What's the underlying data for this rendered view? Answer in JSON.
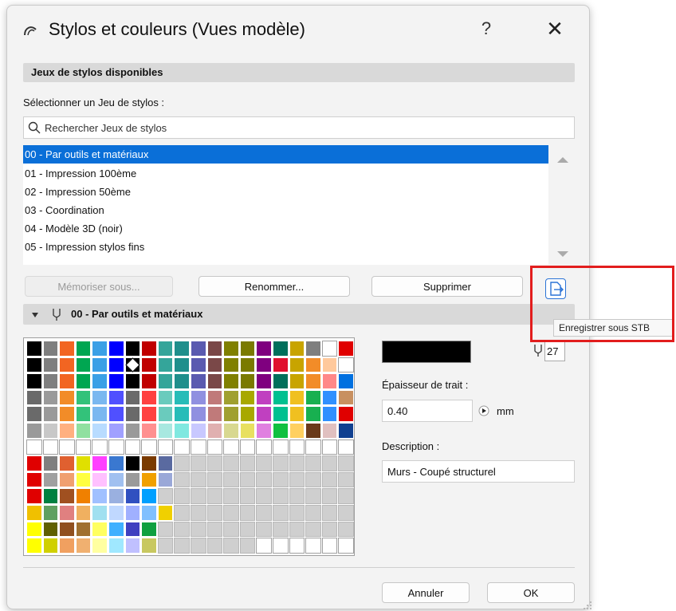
{
  "window": {
    "title": "Stylos et couleurs (Vues modèle)",
    "help": "?",
    "close": "✕"
  },
  "pen_sets": {
    "section_title": "Jeux de stylos disponibles",
    "select_label": "Sélectionner un Jeu de stylos :",
    "search_placeholder": "Rechercher Jeux de stylos",
    "items": [
      "00 - Par outils et matériaux",
      "01 - Impression 100ème",
      "02 - Impression 50ème",
      "03 - Coordination",
      "04 - Modèle 3D (noir)",
      "05 - Impression stylos fins"
    ],
    "selected_index": 0
  },
  "buttons": {
    "save_as": "Mémoriser sous...",
    "rename": "Renommer...",
    "delete": "Supprimer",
    "cancel": "Annuler",
    "ok": "OK"
  },
  "tooltip": "Enregistrer sous STB",
  "pen": {
    "set_name": "00 - Par outils et matériaux",
    "number": "27",
    "color": "#000000",
    "thickness_label": "Épaisseur de trait :",
    "thickness_value": "0.40",
    "thickness_unit": "mm",
    "description_label": "Description :",
    "description_value": "Murs - Coupé structurel"
  },
  "colors": {
    "accent": "#0a6fd8",
    "highlight": "#e21d1d"
  },
  "palette": {
    "columns": 20,
    "selected": [
      5,
      2
    ],
    "rows": [
      [
        "#000000",
        "#7f7f7f",
        "#f26522",
        "#00a651",
        "#3aa0e6",
        "#0000ff",
        "#000000",
        "#c00000",
        "#34a59a",
        "#1f8f8c",
        "#5a5ab0",
        "#7a4848",
        "#808000",
        "#7a7a00",
        "#7f007f",
        "#006f5b",
        "#c8a400",
        "#7f7f7f",
        "#ffffff",
        "#e00000"
      ],
      [
        "#000000",
        "#7f7f7f",
        "#f26522",
        "#00a651",
        "#3aa0e6",
        "#0000ff",
        "#000000",
        "#c00000",
        "#34a59a",
        "#1f8f8c",
        "#5a5ab0",
        "#7a4848",
        "#808000",
        "#7a7a00",
        "#7f007f",
        "#e0102f",
        "#c8a400",
        "#f28c28",
        "#ffc99c",
        "#ffffff"
      ],
      [
        "#000000",
        "#7f7f7f",
        "#f26522",
        "#00a651",
        "#3aa0e6",
        "#0000ff",
        "#000000",
        "#c00000",
        "#34a59a",
        "#1f8f8c",
        "#5a5ab0",
        "#7a4848",
        "#808000",
        "#7a7a00",
        "#7f007f",
        "#006f5b",
        "#c8a400",
        "#f28c28",
        "#ff8888",
        "#0070e0"
      ],
      [
        "#6a6a6a",
        "#9a9a9a",
        "#f28c28",
        "#33c27a",
        "#7ab8f0",
        "#5050ff",
        "#6a6a6a",
        "#ff4040",
        "#6acbbd",
        "#27bcb8",
        "#9090e0",
        "#c07a7a",
        "#a0a030",
        "#a8a800",
        "#c040c0",
        "#00c090",
        "#f0c020",
        "#18b050",
        "#3090ff",
        "#c89060"
      ],
      [
        "#6a6a6a",
        "#9a9a9a",
        "#f28c28",
        "#33c27a",
        "#7ab8f0",
        "#5050ff",
        "#6a6a6a",
        "#ff4040",
        "#6acbbd",
        "#27bcb8",
        "#9090e0",
        "#c07a7a",
        "#a0a030",
        "#a8a800",
        "#c040c0",
        "#00c090",
        "#f0c020",
        "#18b050",
        "#3090ff",
        "#e00000"
      ],
      [
        "#9a9a9a",
        "#c8c8c8",
        "#ffb080",
        "#90e0a0",
        "#b8dcff",
        "#a0a0ff",
        "#9a9a9a",
        "#ff9090",
        "#a8e8e0",
        "#80e8e0",
        "#c8c8ff",
        "#e0b0b0",
        "#d8d890",
        "#e8e060",
        "#e080e0",
        "#10c040",
        "#ffd060",
        "#6a3a1a",
        "#e0c0c0",
        "#104090"
      ],
      [
        "#ffffff",
        "#ffffff",
        "#ffffff",
        "#ffffff",
        "#ffffff",
        "#ffffff",
        "#ffffff",
        "#ffffff",
        "#ffffff",
        "#ffffff",
        "#ffffff",
        "#ffffff",
        "#ffffff",
        "#ffffff",
        "#ffffff",
        "#ffffff",
        "#ffffff",
        "#ffffff",
        "#ffffff",
        "#ffffff"
      ],
      [
        "#e00000",
        "#7f7f7f",
        "#e06030",
        "#e0e000",
        "#ff40ff",
        "#3a78d0",
        "#000000",
        "#7a3a00",
        "#5a6aa0",
        "#cfcfcf",
        "#cfcfcf",
        "#cfcfcf",
        "#cfcfcf",
        "#cfcfcf",
        "#cfcfcf",
        "#cfcfcf",
        "#cfcfcf",
        "#cfcfcf",
        "#cfcfcf",
        "#cfcfcf"
      ],
      [
        "#e00000",
        "#a0a0a0",
        "#f0a070",
        "#ffff40",
        "#ffc0ff",
        "#a0c0f0",
        "#9a9a9a",
        "#f0a000",
        "#9aa8d8",
        "#cfcfcf",
        "#cfcfcf",
        "#cfcfcf",
        "#cfcfcf",
        "#cfcfcf",
        "#cfcfcf",
        "#cfcfcf",
        "#cfcfcf",
        "#cfcfcf",
        "#cfcfcf",
        "#cfcfcf"
      ],
      [
        "#e00000",
        "#008040",
        "#a05020",
        "#f08000",
        "#a0c0ff",
        "#9ab0e0",
        "#3050c0",
        "#00a0ff",
        "#cfcfcf",
        "#cfcfcf",
        "#cfcfcf",
        "#cfcfcf",
        "#cfcfcf",
        "#cfcfcf",
        "#cfcfcf",
        "#cfcfcf",
        "#cfcfcf",
        "#cfcfcf",
        "#cfcfcf",
        "#cfcfcf"
      ],
      [
        "#f0c000",
        "#60a060",
        "#e08080",
        "#f0b060",
        "#a0e0f0",
        "#c0d8ff",
        "#a0b0ff",
        "#80c0ff",
        "#f0d000",
        "#cfcfcf",
        "#cfcfcf",
        "#cfcfcf",
        "#cfcfcf",
        "#cfcfcf",
        "#cfcfcf",
        "#cfcfcf",
        "#cfcfcf",
        "#cfcfcf",
        "#cfcfcf",
        "#cfcfcf"
      ],
      [
        "#ffff00",
        "#606000",
        "#905020",
        "#a07030",
        "#ffff60",
        "#40b0ff",
        "#4040c0",
        "#10a040",
        "#cfcfcf",
        "#cfcfcf",
        "#cfcfcf",
        "#cfcfcf",
        "#cfcfcf",
        "#cfcfcf",
        "#cfcfcf",
        "#cfcfcf",
        "#cfcfcf",
        "#cfcfcf",
        "#cfcfcf",
        "#cfcfcf"
      ],
      [
        "#ffff00",
        "#d0d000",
        "#f0a060",
        "#f0b070",
        "#ffffa0",
        "#a0e8ff",
        "#c0c0ff",
        "#c8c860",
        "#cfcfcf",
        "#cfcfcf",
        "#cfcfcf",
        "#cfcfcf",
        "#cfcfcf",
        "#cfcfcf",
        "#ffffff",
        "#ffffff",
        "#ffffff",
        "#ffffff",
        "#ffffff",
        "#ffffff"
      ]
    ]
  }
}
